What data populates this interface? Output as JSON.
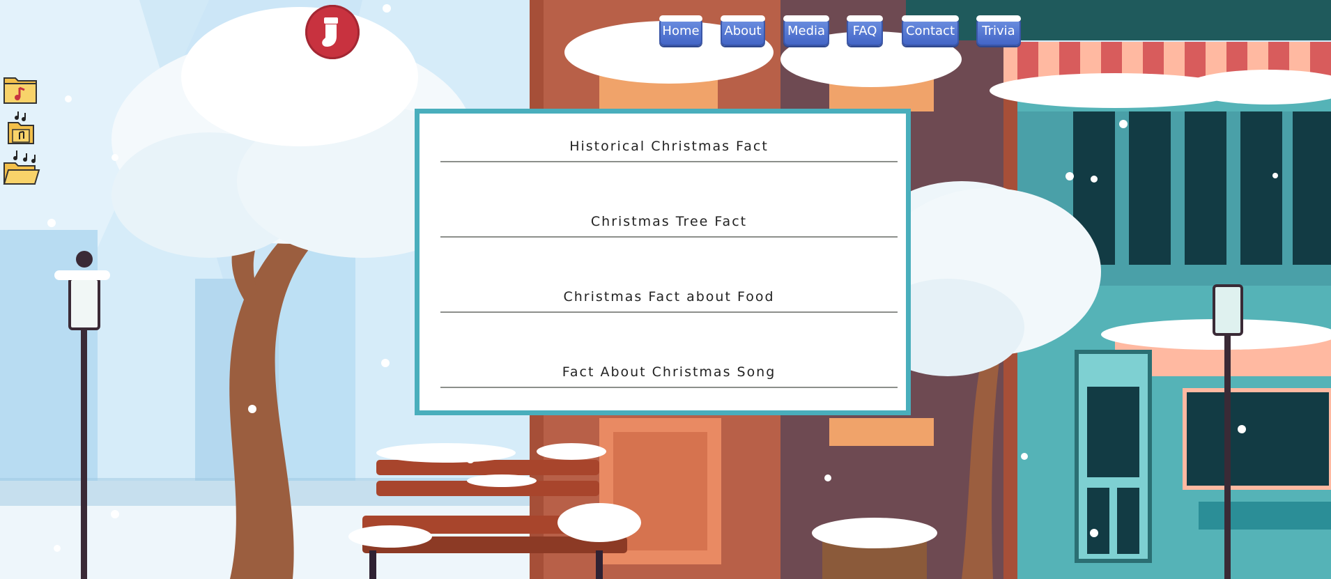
{
  "nav": {
    "items": [
      {
        "label": "Home"
      },
      {
        "label": "About"
      },
      {
        "label": "Media"
      },
      {
        "label": "FAQ"
      },
      {
        "label": "Contact"
      },
      {
        "label": "Trivia"
      }
    ]
  },
  "desktop_icons": [
    "music-folder-icon",
    "music-note-folder-icon",
    "open-music-folder-icon"
  ],
  "logo": {
    "icon": "stocking-icon",
    "color": "#c8323f"
  },
  "facts": {
    "items": [
      {
        "label": "Historical Christmas Fact"
      },
      {
        "label": "Christmas Tree Fact"
      },
      {
        "label": "Christmas Fact about Food"
      },
      {
        "label": "Fact About Christmas Song"
      }
    ]
  },
  "colors": {
    "panel_border": "#49aebc",
    "nav_button": "#4f74d1"
  }
}
